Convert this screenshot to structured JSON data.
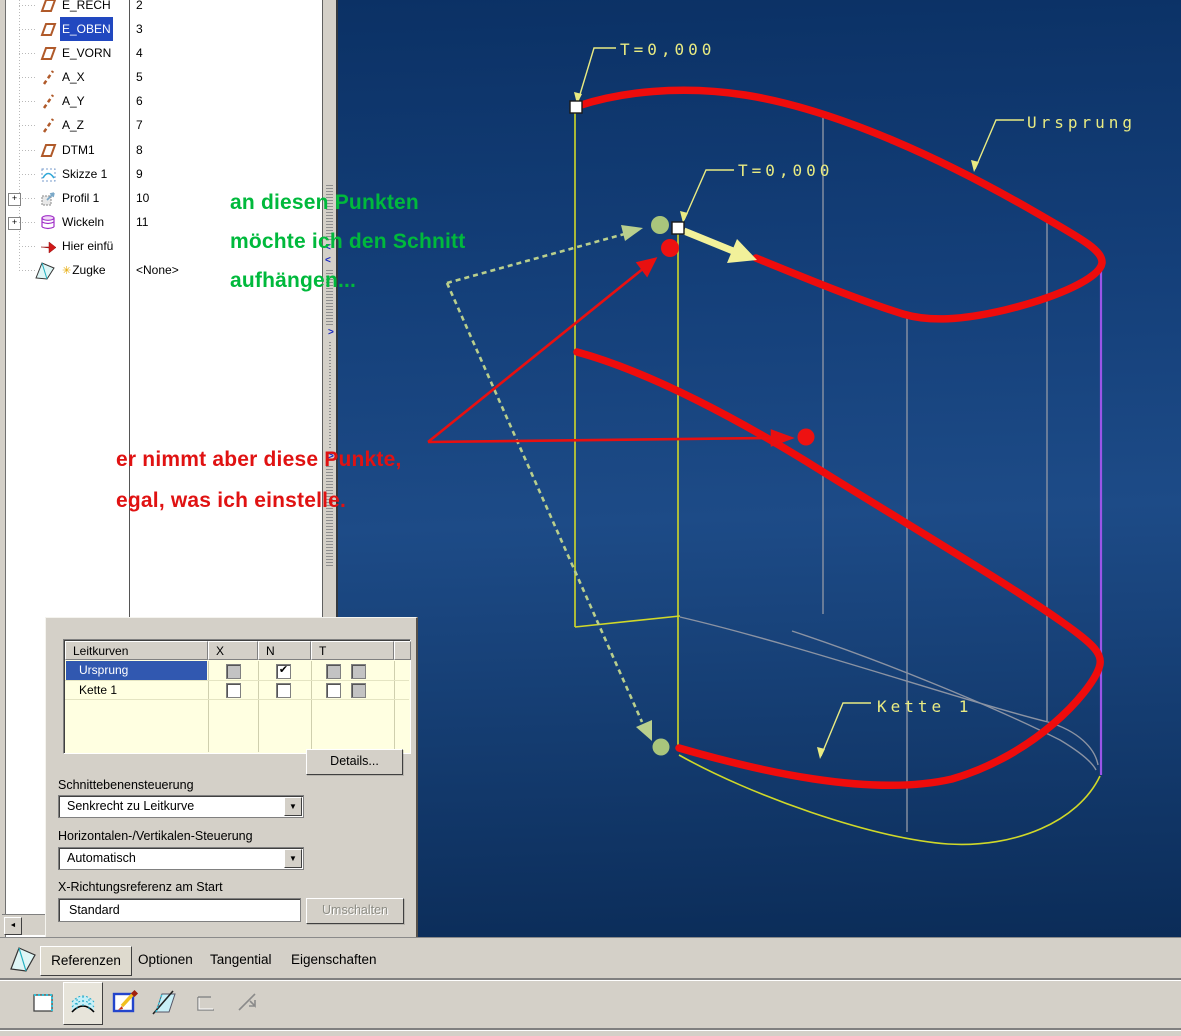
{
  "model_tree": {
    "items": [
      {
        "label": "E_RECH",
        "num": "2",
        "icon": "datum-plane",
        "selected": false
      },
      {
        "label": "E_OBEN",
        "num": "3",
        "icon": "datum-plane",
        "selected": true
      },
      {
        "label": "E_VORN",
        "num": "4",
        "icon": "datum-plane",
        "selected": false
      },
      {
        "label": "A_X",
        "num": "5",
        "icon": "datum-axis",
        "selected": false
      },
      {
        "label": "A_Y",
        "num": "6",
        "icon": "datum-axis",
        "selected": false
      },
      {
        "label": "A_Z",
        "num": "7",
        "icon": "datum-axis",
        "selected": false
      },
      {
        "label": "DTM1",
        "num": "8",
        "icon": "datum-plane",
        "selected": false
      },
      {
        "label": "Skizze 1",
        "num": "9",
        "icon": "sketch",
        "selected": false
      },
      {
        "label": "Profil 1",
        "num": "10",
        "icon": "profile",
        "selected": false,
        "expandable": true
      },
      {
        "label": "Wickeln",
        "num": "11",
        "icon": "wrap",
        "selected": false,
        "expandable": true
      },
      {
        "label": "Hier einfü",
        "num": "",
        "icon": "insert-here",
        "selected": false
      },
      {
        "label": "Zugke",
        "prefix": "✳",
        "num": "<None>",
        "icon": "sweep",
        "selected": false
      }
    ]
  },
  "annotations": {
    "green": [
      "an diesen Punkten",
      "möchte ich den Schnitt",
      "aufhängen..."
    ],
    "red": [
      "er nimmt aber diese Punkte,",
      "egal, was ich einstelle."
    ]
  },
  "viewport_labels": {
    "t_origin": "T=0,000",
    "t_point": "T=0,000",
    "origin_curve": "Ursprung",
    "chain_curve": "Kette 1"
  },
  "panel": {
    "table": {
      "headers": [
        "Leitkurven",
        "X",
        "N",
        "T"
      ],
      "rows": [
        {
          "name": "Ursprung",
          "selected": true,
          "x": "disabled",
          "n": "checked",
          "t1": "disabled",
          "t2": "disabled"
        },
        {
          "name": "Kette 1",
          "selected": false,
          "x": "unchecked",
          "n": "unchecked",
          "t1": "unchecked",
          "t2": "disabled"
        }
      ]
    },
    "details_button": "Details...",
    "fields": [
      {
        "label": "Schnittebenensteuerung",
        "value": "Senkrecht zu Leitkurve",
        "type": "select"
      },
      {
        "label": "Horizontalen-/Vertikalen-Steuerung",
        "value": "Automatisch",
        "type": "select"
      },
      {
        "label": "X-Richtungsreferenz am Start",
        "value": "Standard",
        "type": "text"
      }
    ],
    "toggle_button": "Umschalten"
  },
  "tabs": [
    {
      "label": "Referenzen",
      "active": true
    },
    {
      "label": "Optionen",
      "active": false
    },
    {
      "label": "Tangential",
      "active": false
    },
    {
      "label": "Eigenschaften",
      "active": false
    }
  ],
  "scrollbar": {
    "left_arrow": "◄"
  },
  "colors": {
    "selection_blue": "#2148c0",
    "table_row_blue": "#3158b0",
    "viewport_label_yellow": "#e9eb82",
    "curve_red": "#ee0c0c",
    "sketch_yellow": "#d0d829",
    "chain_purple": "#9a55e8",
    "annotation_green": "#00b93c",
    "annotation_red": "#e01212"
  }
}
